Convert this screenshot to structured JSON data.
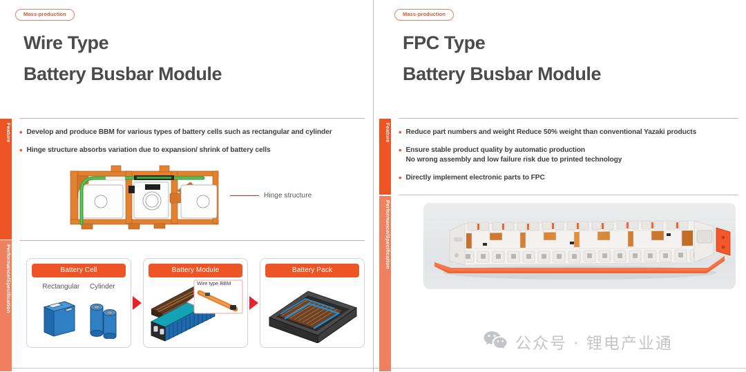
{
  "colors": {
    "accent": "#ee5524",
    "accent_light": "#f08160",
    "badge_border": "#ef7b63",
    "badge_text": "#d6533a",
    "title": "#4d4a4b",
    "body_text": "#3f3d3e",
    "rule": "#b9bcc0",
    "callout_red": "#e21f26",
    "watermark": "#c3c5c8"
  },
  "panels": [
    {
      "badge": "Mass-production",
      "title_line1": "Wire Type",
      "title_line2": "Battery Busbar Module",
      "tabs": [
        {
          "label": "Feature",
          "active": true
        },
        {
          "label": "Performance/Specification",
          "active": false
        }
      ],
      "bullets": [
        {
          "text": "Develop and produce BBM for various types of battery cells such as rectangular and cylinder",
          "sub": ""
        },
        {
          "text": "Hinge structure absorbs variation due to expansion/ shrink of battery cells",
          "sub": ""
        }
      ],
      "figure": {
        "name": "hinge-structure-diagram",
        "callout_label": "Hinge structure"
      },
      "process": {
        "steps": [
          {
            "header": "Battery Cell",
            "items": [
              "Rectangular",
              "Cylinder"
            ]
          },
          {
            "header": "Battery Module",
            "callout": "Wire type BBM"
          },
          {
            "header": "Battery Pack"
          }
        ]
      }
    },
    {
      "badge": "Mass-production",
      "title_line1": "FPC Type",
      "title_line2": "Battery Busbar Module",
      "tabs": [
        {
          "label": "Feature",
          "active": true
        },
        {
          "label": "Performance/Specification",
          "active": false
        }
      ],
      "bullets": [
        {
          "text": "Reduce part numbers and weight Reduce 50% weight than conventional Yazaki products",
          "sub": ""
        },
        {
          "text": "Ensure stable product quality by automatic production",
          "sub": "No wrong assembly and low failure risk due to printed technology"
        },
        {
          "text": "Directly implement electronic parts to FPC",
          "sub": ""
        }
      ],
      "photo": {
        "name": "fpc-busbar-module-photo"
      }
    }
  ],
  "watermark": {
    "icon": "wechat-icon",
    "text": "公众号 · 锂电产业通"
  }
}
